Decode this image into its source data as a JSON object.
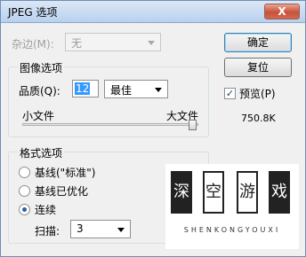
{
  "window": {
    "title": "JPEG 选项",
    "close_label": "X"
  },
  "matte": {
    "label": "杂边(M):",
    "value": "无"
  },
  "image_options": {
    "title": "图像选项",
    "quality_label": "品质(Q):",
    "quality_value": "12",
    "quality_preset": "最佳",
    "small_file_label": "小文件",
    "large_file_label": "大文件",
    "quality_level": 1.0
  },
  "buttons": {
    "ok": "确定",
    "reset": "复位"
  },
  "preview": {
    "label": "预览(P)",
    "checked": true,
    "file_size": "750.8K"
  },
  "format_options": {
    "title": "格式选项",
    "options": [
      {
        "label": "基线(\"标准\")",
        "selected": false
      },
      {
        "label": "基线已优化",
        "selected": false
      },
      {
        "label": "连续",
        "selected": true
      }
    ],
    "scans_label": "扫描:",
    "scans_value": "3"
  },
  "logo": {
    "chars": [
      "深",
      "空",
      "游",
      "戏"
    ],
    "subtitle": "SHENKONGYOUXI"
  }
}
